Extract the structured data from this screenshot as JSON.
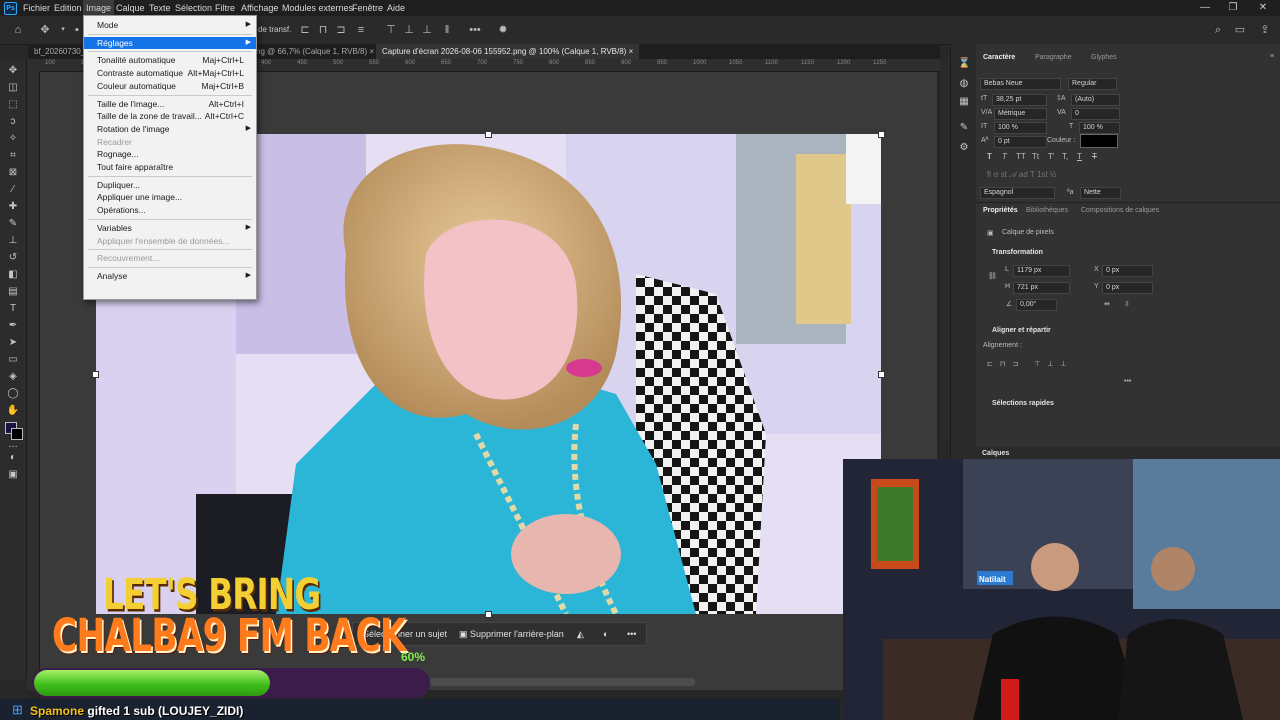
{
  "app": {
    "logo": "Ps"
  },
  "menubar": {
    "items": [
      "Fichier",
      "Edition",
      "Image",
      "Calque",
      "Texte",
      "Sélection",
      "Filtre",
      "Affichage",
      "Modules externes",
      "Fenêtre",
      "Aide"
    ],
    "active": "Image"
  },
  "window_controls": {
    "minimize": "—",
    "maximize": "❐",
    "close": "✕"
  },
  "optionsbar": {
    "transform_label": "de transf."
  },
  "tabs": [
    {
      "label": "bf_20260730_"
    },
    {
      "label": "ng @ 66,7% (Calque 1, RVB/8)",
      "close": "×"
    },
    {
      "label": "Capture d'écran 2026-08-06 155952.png @ 100% (Calque 1, RVB/8)",
      "close": "×",
      "active": true
    }
  ],
  "ruler": {
    "ticks": [
      "100",
      "150",
      "200",
      "250",
      "300",
      "350",
      "400",
      "450",
      "500",
      "550",
      "600",
      "650",
      "700",
      "750",
      "800",
      "850",
      "900",
      "950",
      "1000",
      "1050",
      "1100",
      "1150",
      "1200",
      "1250"
    ]
  },
  "image_menu": {
    "items": [
      {
        "label": "Mode",
        "submenu": true
      },
      {
        "sep": true
      },
      {
        "label": "Réglages",
        "submenu": true,
        "highlighted": true
      },
      {
        "sep": true
      },
      {
        "label": "Tonalité automatique",
        "shortcut": "Maj+Ctrl+L"
      },
      {
        "label": "Contraste automatique",
        "shortcut": "Alt+Maj+Ctrl+L"
      },
      {
        "label": "Couleur automatique",
        "shortcut": "Maj+Ctrl+B"
      },
      {
        "sep": true
      },
      {
        "label": "Taille de l'image...",
        "shortcut": "Alt+Ctrl+I"
      },
      {
        "label": "Taille de la zone de travail...",
        "shortcut": "Alt+Ctrl+C"
      },
      {
        "label": "Rotation de l'image",
        "submenu": true
      },
      {
        "label": "Recadrer",
        "disabled": true
      },
      {
        "label": "Rognage..."
      },
      {
        "label": "Tout faire apparaître"
      },
      {
        "sep": true
      },
      {
        "label": "Dupliquer..."
      },
      {
        "label": "Appliquer une image..."
      },
      {
        "label": "Opérations..."
      },
      {
        "sep": true
      },
      {
        "label": "Variables",
        "submenu": true
      },
      {
        "label": "Appliquer l'ensemble de données...",
        "disabled": true
      },
      {
        "sep": true
      },
      {
        "label": "Recouvrement...",
        "disabled": true
      },
      {
        "sep": true
      },
      {
        "label": "Analyse",
        "submenu": true
      }
    ]
  },
  "context_bar": {
    "select_subject": "Sélectionner un sujet",
    "remove_bg": "Supprimer l'arrière-plan",
    "more": "•••"
  },
  "character_panel": {
    "tabs": [
      "Caractère",
      "Paragraphe",
      "Glyphes"
    ],
    "font_family": "Bebas Neue",
    "font_style": "Regular",
    "size": "38,25 pt",
    "leading": "(Auto)",
    "kerning": "Métrique",
    "tracking": "0",
    "vscale": "100 %",
    "hscale": "100 %",
    "baseline": "0 pt",
    "color_label": "Couleur :",
    "text_color": "#000000",
    "style_buttons": [
      "T",
      "T",
      "TT",
      "Tt",
      "T'",
      "T,",
      "T",
      "T"
    ],
    "language": "Espagnol",
    "antialias": "Nette",
    "aa_label": "ªa"
  },
  "properties_panel": {
    "tabs": [
      "Propriétés",
      "Bibliothèques",
      "Compositions de calques"
    ],
    "layer_type": "Calque de pixels",
    "transform_title": "Transformation",
    "w_label": "L",
    "w": "1179 px",
    "h_label": "H",
    "h": "721 px",
    "x_label": "X",
    "x": "0 px",
    "y_label": "Y",
    "y": "0 px",
    "angle": "0,00°",
    "align_title": "Aligner et répartir",
    "align_label": "Alignement :",
    "quick_title": "Sélections rapides",
    "more": "•••"
  },
  "layers_panel": {
    "title": "Calques"
  },
  "overlay": {
    "line1": "LET'S BRING",
    "line2": "CHALBA9 FM BACK",
    "progress_value": 0.6,
    "progress_text": "60%",
    "sub_user": "Spamone",
    "sub_text": "gifted 1 sub (LOUJEY_ZIDI)"
  },
  "webcam": {
    "sign_text": "Natilait"
  },
  "colors": {
    "accent": "#1473e6",
    "ps_blue": "#31a8ff",
    "progress_green": "#5ad12a",
    "banner_yellow": "#f3cf33",
    "banner_orange": "#ff7b1c"
  }
}
